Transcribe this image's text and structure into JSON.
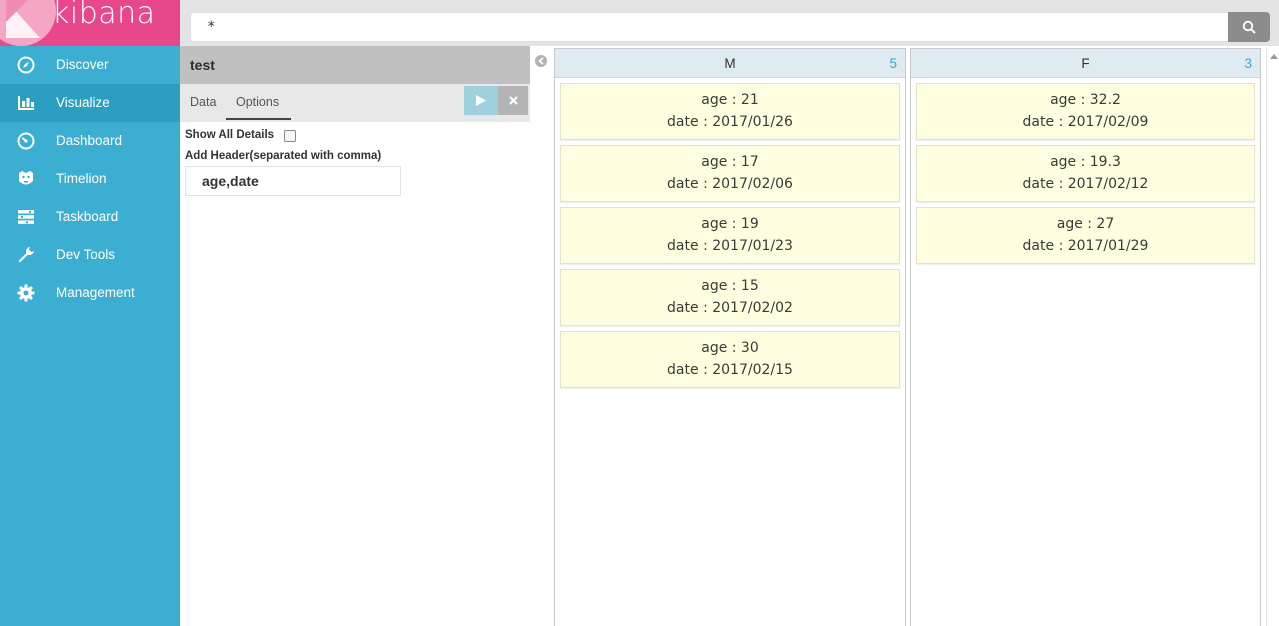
{
  "app": {
    "logo_text": "kibana"
  },
  "sidebar": {
    "items": [
      {
        "label": "Discover",
        "icon": "compass-icon"
      },
      {
        "label": "Visualize",
        "icon": "bar-chart-icon",
        "active": true
      },
      {
        "label": "Dashboard",
        "icon": "dashboard-gauge-icon"
      },
      {
        "label": "Timelion",
        "icon": "timelion-icon"
      },
      {
        "label": "Taskboard",
        "icon": "taskboard-icon"
      },
      {
        "label": "Dev Tools",
        "icon": "wrench-icon"
      },
      {
        "label": "Management",
        "icon": "gear-icon"
      }
    ]
  },
  "search": {
    "query": "*",
    "button_icon": "search-icon"
  },
  "editor": {
    "title": "test",
    "tabs": [
      {
        "label": "Data"
      },
      {
        "label": "Options",
        "active": true
      }
    ],
    "show_all_details_label": "Show All Details",
    "show_all_details_checked": false,
    "add_header_label": "Add Header(separated with comma)",
    "header_value": "age,date"
  },
  "columns": [
    {
      "title": "M",
      "count": "5",
      "cards": [
        {
          "line1": "age : 21",
          "line2": "date : 2017/01/26"
        },
        {
          "line1": "age : 17",
          "line2": "date : 2017/02/06"
        },
        {
          "line1": "age : 19",
          "line2": "date : 2017/01/23"
        },
        {
          "line1": "age : 15",
          "line2": "date : 2017/02/02"
        },
        {
          "line1": "age : 30",
          "line2": "date : 2017/02/15"
        }
      ]
    },
    {
      "title": "F",
      "count": "3",
      "cards": [
        {
          "line1": "age : 32.2",
          "line2": "date : 2017/02/09"
        },
        {
          "line1": "age : 19.3",
          "line2": "date : 2017/02/12"
        },
        {
          "line1": "age : 27",
          "line2": "date : 2017/01/29"
        }
      ]
    }
  ],
  "colors": {
    "sidebar_bg": "#3caed2",
    "sidebar_active": "#2b9ec2",
    "logo_bg": "#e8488b",
    "card_bg": "#fffee0",
    "count_color": "#3aa7d9"
  }
}
